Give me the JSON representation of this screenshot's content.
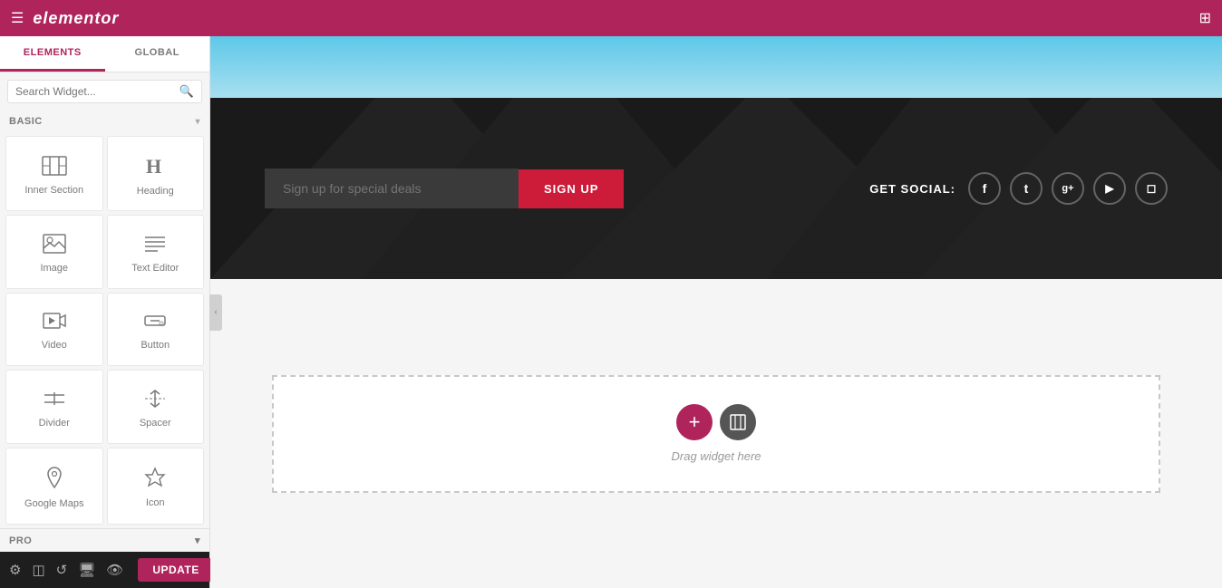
{
  "topbar": {
    "logo": "elementor",
    "hamburger_icon": "☰",
    "grid_icon": "⊞"
  },
  "sidebar": {
    "tabs": [
      {
        "id": "elements",
        "label": "ELEMENTS",
        "active": true
      },
      {
        "id": "global",
        "label": "GLOBAL",
        "active": false
      }
    ],
    "search_placeholder": "Search Widget...",
    "sections": {
      "basic": {
        "label": "BASIC",
        "widgets": [
          {
            "id": "inner-section",
            "label": "Inner Section",
            "icon": "inner-section-icon"
          },
          {
            "id": "heading",
            "label": "Heading",
            "icon": "heading-icon"
          },
          {
            "id": "image",
            "label": "Image",
            "icon": "image-icon"
          },
          {
            "id": "text-editor",
            "label": "Text Editor",
            "icon": "text-editor-icon"
          },
          {
            "id": "video",
            "label": "Video",
            "icon": "video-icon"
          },
          {
            "id": "button",
            "label": "Button",
            "icon": "button-icon"
          },
          {
            "id": "divider",
            "label": "Divider",
            "icon": "divider-icon"
          },
          {
            "id": "spacer",
            "label": "Spacer",
            "icon": "spacer-icon"
          },
          {
            "id": "google-maps",
            "label": "Google Maps",
            "icon": "google-maps-icon"
          },
          {
            "id": "icon",
            "label": "Icon",
            "icon": "icon-icon"
          }
        ]
      },
      "pro": {
        "label": "PRO"
      }
    }
  },
  "bottom_toolbar": {
    "icons": [
      "gear-icon",
      "layers-icon",
      "history-icon",
      "desktop-icon",
      "eye-icon"
    ],
    "update_label": "UPDATE",
    "update_arrow": "▲"
  },
  "canvas": {
    "signup": {
      "placeholder": "Sign up for special deals",
      "button_label": "SIGN UP"
    },
    "social": {
      "label": "GET SOCIAL:",
      "icons": [
        "f",
        "t",
        "g+",
        "▶",
        "◻"
      ]
    },
    "drop_zone": {
      "text": "Drag widget here"
    }
  }
}
